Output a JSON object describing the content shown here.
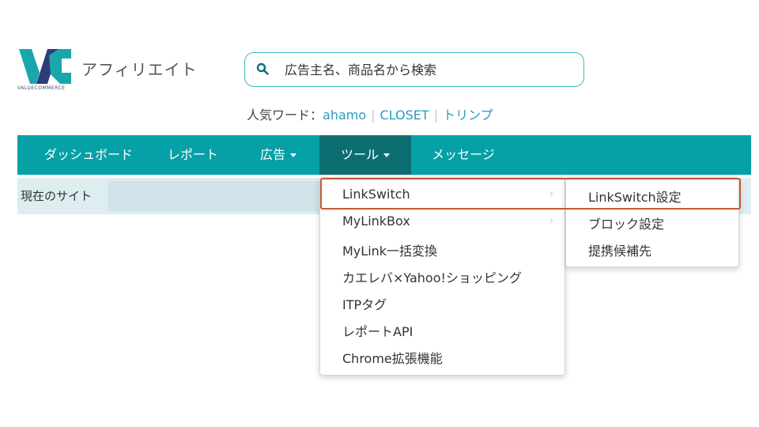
{
  "logo": {
    "text": "アフィリエイト",
    "subtext": "VALUECOMMERCE",
    "colors": {
      "teal": "#19a7ad",
      "navy": "#2c3e7a"
    }
  },
  "search": {
    "placeholder": "広告主名、商品名から検索",
    "value": ""
  },
  "popular": {
    "label": "人気ワード：",
    "words": [
      "ahamo",
      "CLOSET",
      "トリンプ"
    ],
    "separator": "|"
  },
  "nav": {
    "items": [
      {
        "label": "ダッシュボード"
      },
      {
        "label": "レポート"
      },
      {
        "label": "広告",
        "caret": true
      },
      {
        "label": "ツール",
        "caret": true,
        "active": true
      },
      {
        "label": "メッセージ"
      }
    ],
    "color": "#05a1a6",
    "active_color": "#0d6e72"
  },
  "sitebar": {
    "label": "現在のサイト"
  },
  "tools_menu": {
    "items": [
      {
        "label": "LinkSwitch",
        "has_submenu": true,
        "highlighted": true
      },
      {
        "label": "MyLinkBox",
        "has_submenu": true
      },
      {
        "label": "MyLink一括変換"
      },
      {
        "label": "カエレバ×Yahoo!ショッピング"
      },
      {
        "label": "ITPタグ"
      },
      {
        "label": "レポートAPI"
      },
      {
        "label": "Chrome拡張機能"
      }
    ],
    "arrow": "›"
  },
  "linkswitch_submenu": {
    "items": [
      {
        "label": "LinkSwitch設定",
        "highlighted": true
      },
      {
        "label": "ブロック設定"
      },
      {
        "label": "提携候補先"
      }
    ]
  },
  "highlight_color": "#c25b36"
}
